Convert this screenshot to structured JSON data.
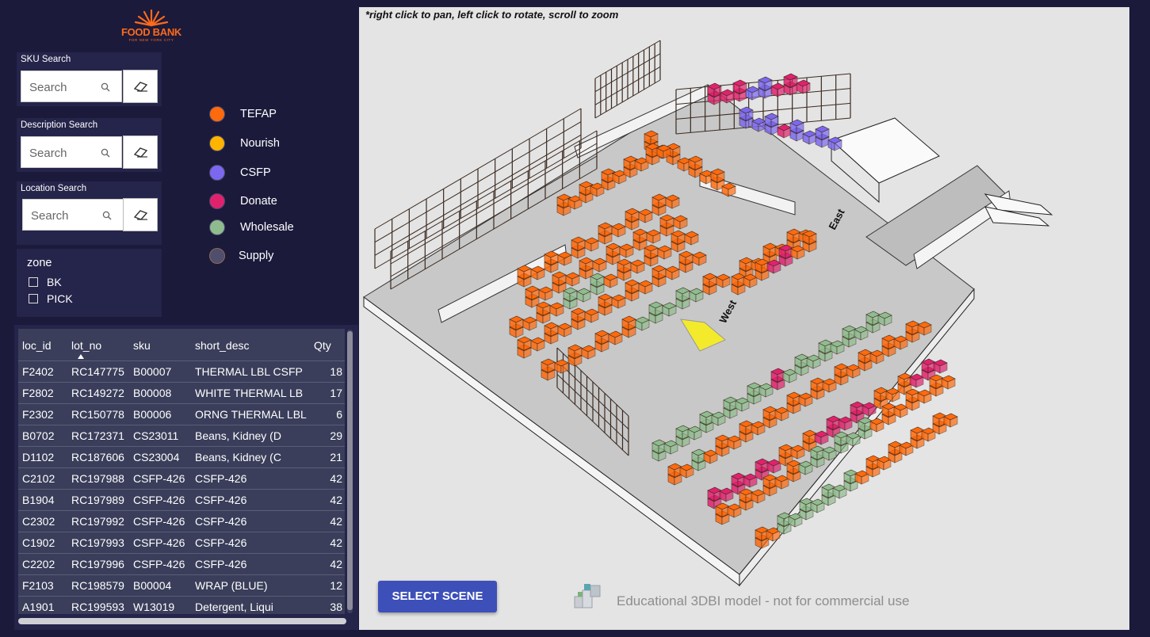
{
  "logo": {
    "text": "FOOD BANK",
    "subtext": "FOR NEW YORK CITY"
  },
  "searches": [
    {
      "title": "SKU Search",
      "placeholder": "Search"
    },
    {
      "title": "Description Search",
      "placeholder": "Search"
    },
    {
      "title": "Location Search",
      "placeholder": "Search"
    }
  ],
  "legend": [
    {
      "label": "TEFAP",
      "color": "#ff6a0d"
    },
    {
      "label": "Nourish",
      "color": "#ffb400"
    },
    {
      "label": "CSFP",
      "color": "#7b68ee"
    },
    {
      "label": "Donate",
      "color": "#e0226e"
    },
    {
      "label": "Wholesale",
      "color": "#8fbc8f"
    },
    {
      "label": "Supply",
      "color": "#4f4e6d"
    }
  ],
  "zone": {
    "title": "zone",
    "options": [
      "BK",
      "PICK"
    ]
  },
  "table": {
    "columns": [
      "loc_id",
      "lot_no",
      "sku",
      "short_desc",
      "Qty"
    ],
    "rows": [
      [
        "F2402",
        "RC147775",
        "B00007",
        "THERMAL LBL CSFP",
        "18"
      ],
      [
        "F2802",
        "RC149272",
        "B00008",
        "WHITE THERMAL LB",
        "17"
      ],
      [
        "F2302",
        "RC150778",
        "B00006",
        "ORNG THERMAL LBL",
        "6"
      ],
      [
        "B0702",
        "RC172371",
        "CS23011",
        "Beans, Kidney (D",
        "29"
      ],
      [
        "D1102",
        "RC187606",
        "CS23004",
        "Beans, Kidney (C",
        "21"
      ],
      [
        "C2102",
        "RC197988",
        "CSFP-426",
        "CSFP-426",
        "42"
      ],
      [
        "B1904",
        "RC197989",
        "CSFP-426",
        "CSFP-426",
        "42"
      ],
      [
        "C2302",
        "RC197992",
        "CSFP-426",
        "CSFP-426",
        "42"
      ],
      [
        "C1902",
        "RC197993",
        "CSFP-426",
        "CSFP-426",
        "42"
      ],
      [
        "C2202",
        "RC197996",
        "CSFP-426",
        "CSFP-426",
        "42"
      ],
      [
        "F2103",
        "RC198579",
        "B00004",
        "WRAP (BLUE)",
        "12"
      ],
      [
        "A1901",
        "RC199593",
        "W13019",
        "Detergent, Liqui",
        "38"
      ]
    ]
  },
  "viewport": {
    "hint": "*right click to pan, left click to rotate, scroll to zoom",
    "select_scene": "SELECT SCENE",
    "watermark": "Educational 3DBI model - not for commercial use",
    "labels": [
      "East",
      "West"
    ]
  }
}
